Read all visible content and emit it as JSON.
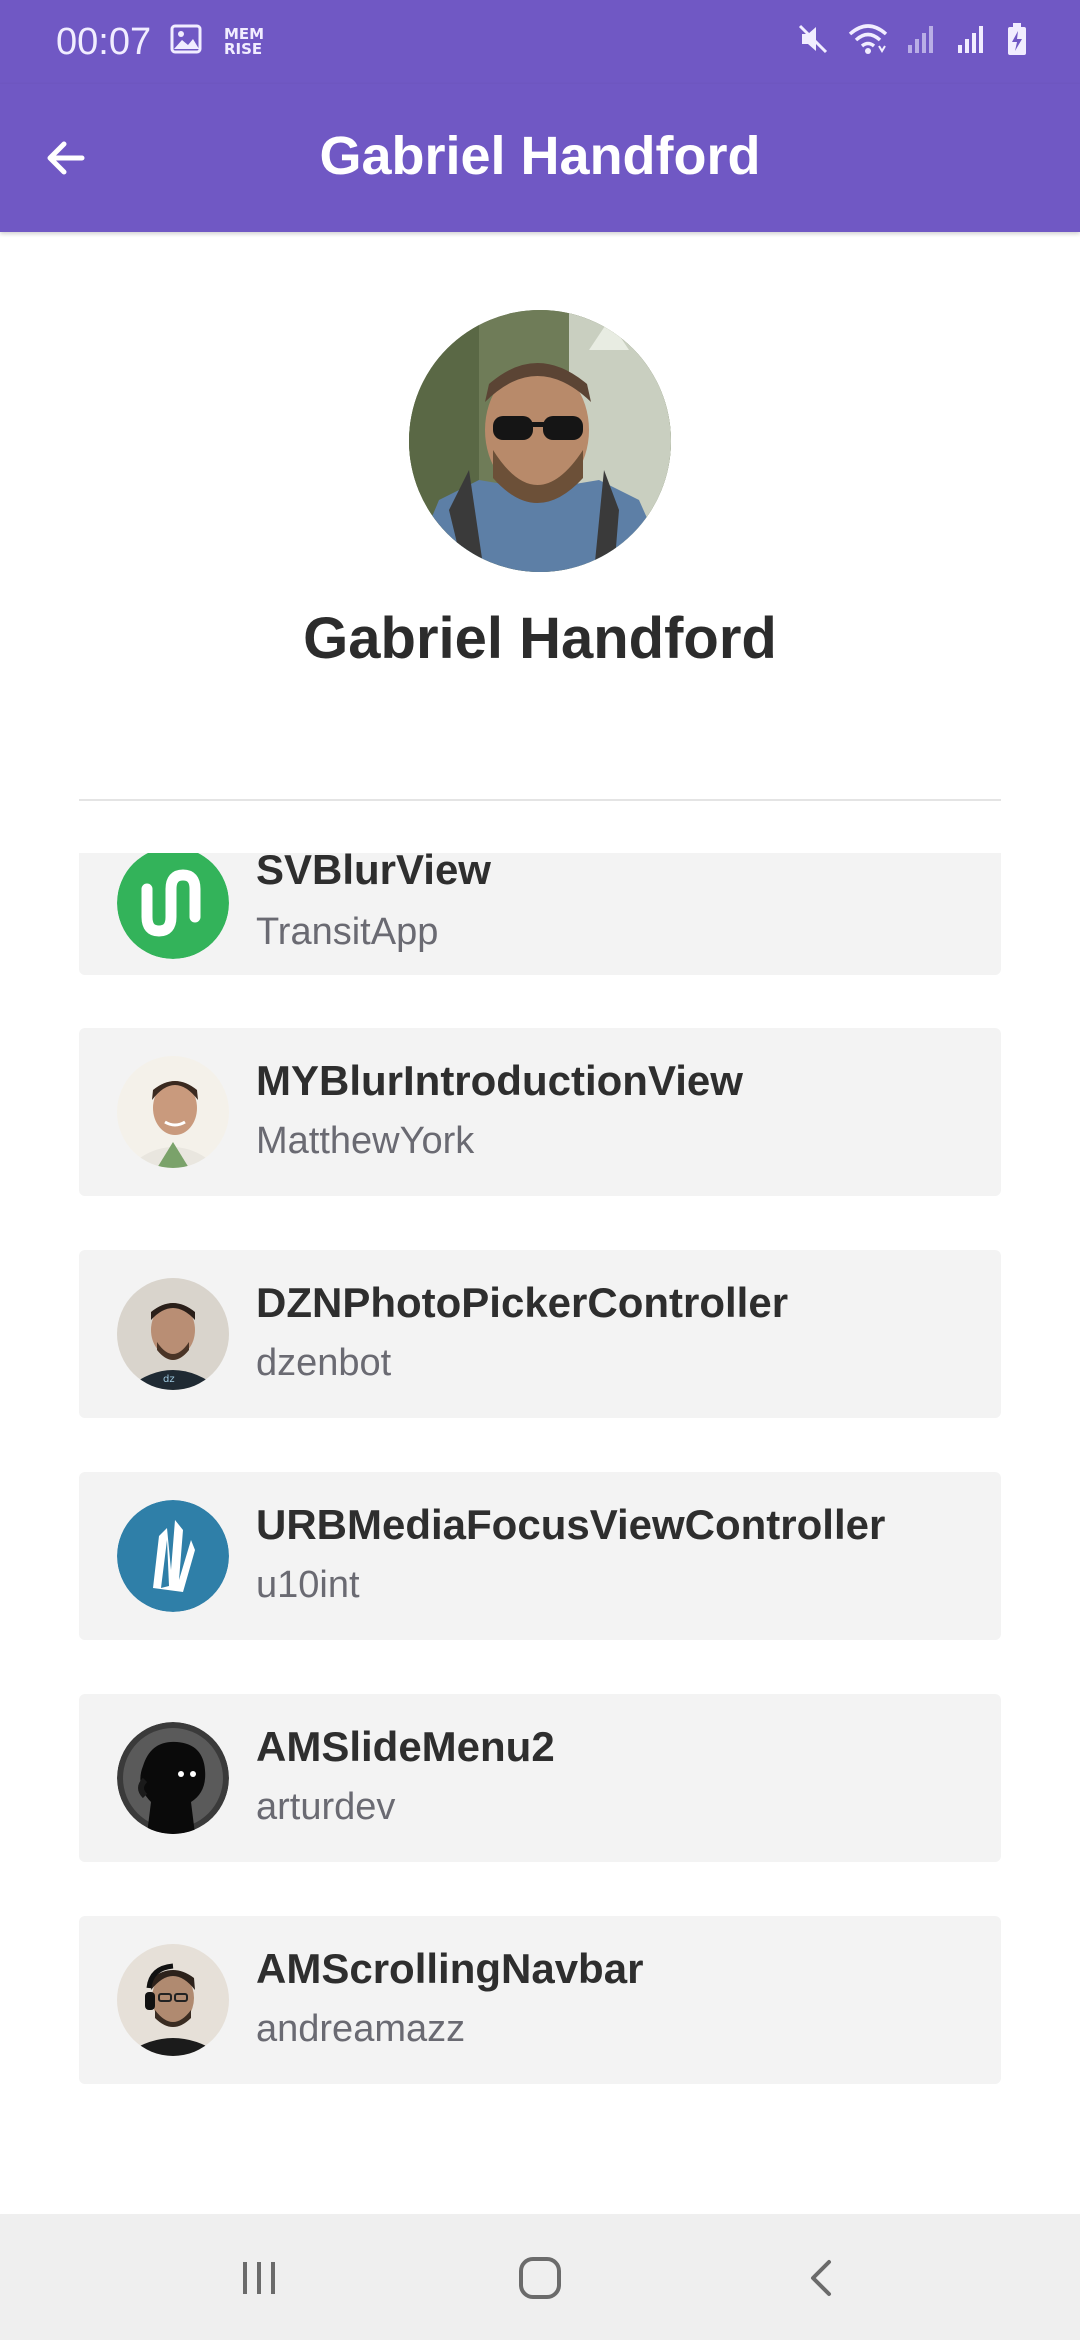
{
  "status_bar": {
    "time": "00:07",
    "left_icons": [
      "image-icon",
      "memrise-icon"
    ],
    "memrise_text_top": "MEM",
    "memrise_text_bottom": "RISE",
    "right_icons": [
      "mute-icon",
      "wifi-icon",
      "signal-icon",
      "signal-icon",
      "battery-charging-icon"
    ]
  },
  "app_bar": {
    "title": "Gabriel Handford",
    "back_icon": "arrow-left-icon"
  },
  "profile": {
    "name": "Gabriel Handford"
  },
  "repos": [
    {
      "name": "SVBlurView",
      "owner": "TransitApp",
      "avatar": "transitapp-logo"
    },
    {
      "name": "MYBlurIntroductionView",
      "owner": "MatthewYork",
      "avatar": "user-photo"
    },
    {
      "name": "DZNPhotoPickerController",
      "owner": "dzenbot",
      "avatar": "user-photo"
    },
    {
      "name": "URBMediaFocusViewController",
      "owner": "u10int",
      "avatar": "u10int-logo"
    },
    {
      "name": "AMSlideMenu2",
      "owner": "arturdev",
      "avatar": "user-silhouette"
    },
    {
      "name": "AMScrollingNavbar",
      "owner": "andreamazz",
      "avatar": "user-photo"
    }
  ],
  "nav_bar": {
    "items": [
      "recents-icon",
      "home-icon",
      "back-icon"
    ]
  },
  "colors": {
    "primary": "#7058c4",
    "card_background": "#f3f3f3",
    "transit_green": "#33b35a",
    "u10int_blue": "#2f7fa8"
  }
}
